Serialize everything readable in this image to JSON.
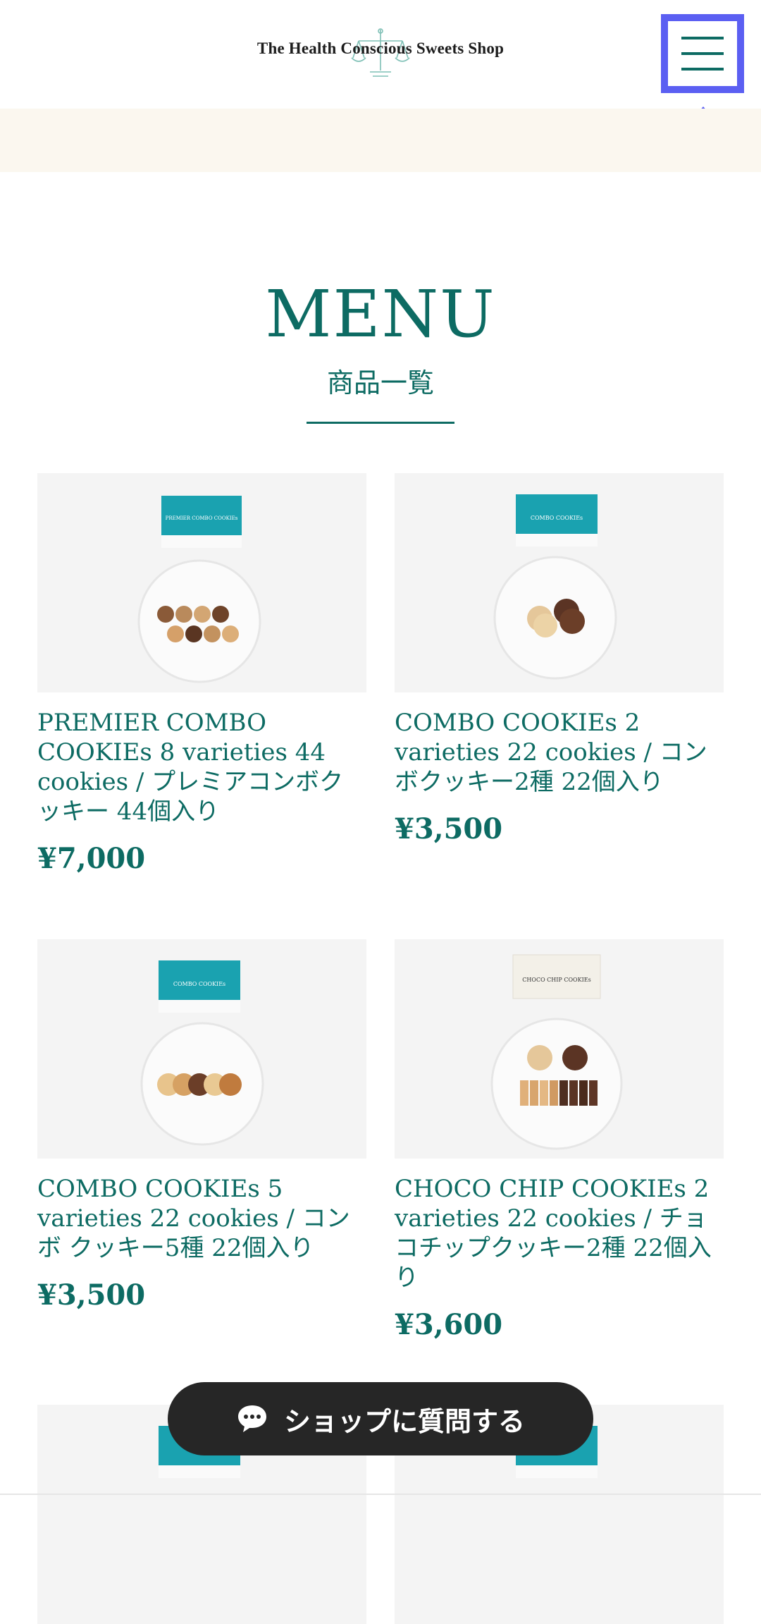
{
  "header": {
    "logo_text": "The Health Conscious Sweets Shop",
    "menu_icon": "hamburger-icon"
  },
  "section": {
    "title": "MENU",
    "subtitle": "商品一覧"
  },
  "products": [
    {
      "name": "PREMIER COMBO COOKIEs 8 varieties 44 cookies / プレミアコンボクッキー 44個入り",
      "price": "¥7,000",
      "box_label": "PREMIER COMBO COOKIEs",
      "box_color": "#1aa2b0"
    },
    {
      "name": "COMBO COOKIEs 2 varieties 22 cookies / コンボクッキー2種 22個入り",
      "price": "¥3,500",
      "box_label": "COMBO COOKIEs",
      "box_color": "#1aa2b0"
    },
    {
      "name": "COMBO COOKIEs 5 varieties 22 cookies / コンボ クッキー5種 22個入り",
      "price": "¥3,500",
      "box_label": "COMBO COOKIEs",
      "box_color": "#1aa2b0"
    },
    {
      "name": "CHOCO CHIP COOKIEs 2 varieties 22 cookies / チョコチップクッキー2種 22個入り",
      "price": "¥3,600",
      "box_label": "CHOCO CHIP COOKIEs",
      "box_color": "#f3f0e8"
    }
  ],
  "chat": {
    "label": "ショップに質問する",
    "icon": "chat-bubble-icon"
  },
  "colors": {
    "brand": "#0d6b63",
    "highlight": "#5b5ff2",
    "banner": "#fbf7ef",
    "chat_bg": "#262626"
  }
}
